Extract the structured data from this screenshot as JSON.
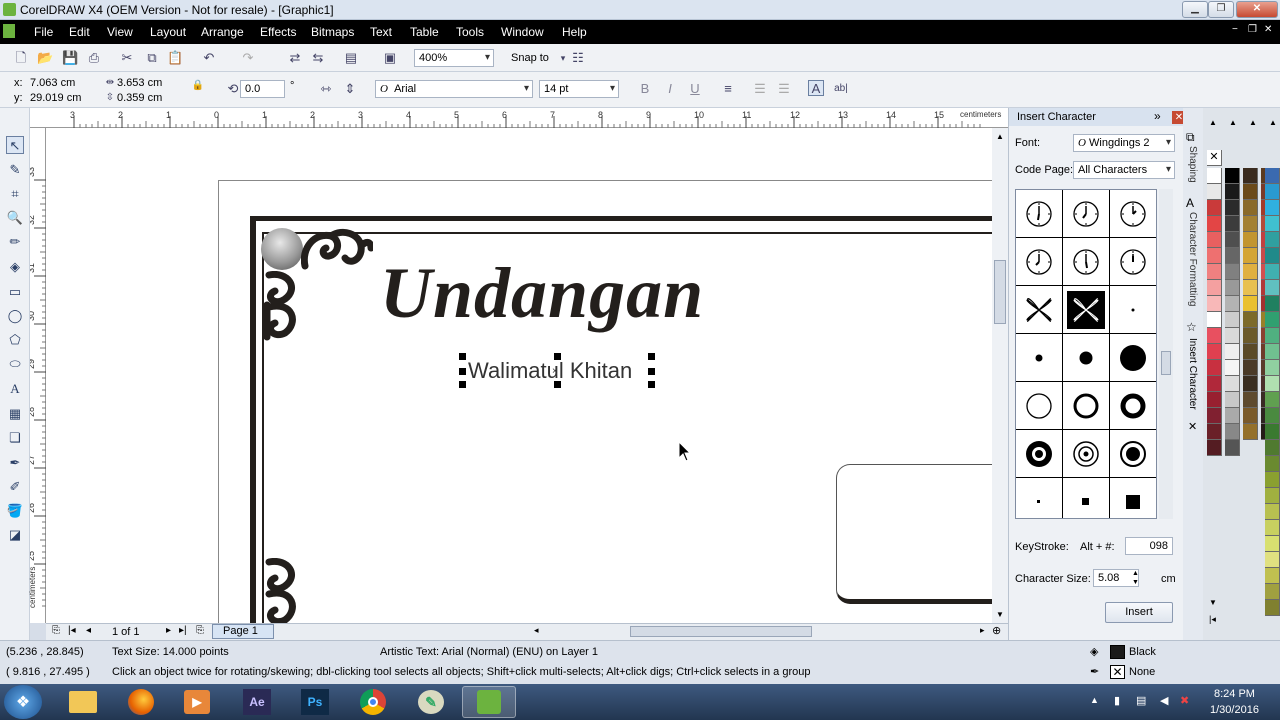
{
  "title_bar": {
    "title": "CorelDRAW X4 (OEM Version - Not for resale) - [Graphic1]"
  },
  "menu": {
    "file": "File",
    "edit": "Edit",
    "view": "View",
    "layout": "Layout",
    "arrange": "Arrange",
    "effects": "Effects",
    "bitmaps": "Bitmaps",
    "text": "Text",
    "table": "Table",
    "tools": "Tools",
    "window": "Window",
    "help": "Help"
  },
  "toolbar1": {
    "zoom_value": "400%",
    "snap_label": "Snap to"
  },
  "property_bar": {
    "x_label": "x:",
    "x_value": "7.063 cm",
    "y_label": "y:",
    "y_value": "29.019 cm",
    "width_value": "3.653 cm",
    "height_value": "0.359 cm",
    "rotation_value": "0.0",
    "rotation_unit": "°",
    "font_name": "Arial",
    "font_size": "14 pt"
  },
  "ruler": {
    "units": "centimeters",
    "h_ticks": [
      "3",
      "2",
      "1",
      "0",
      "1",
      "2",
      "3",
      "4",
      "5",
      "6",
      "7",
      "8",
      "9",
      "10",
      "11",
      "12",
      "13",
      "14",
      "15"
    ],
    "v_ticks": [
      "33",
      "32",
      "31",
      "30",
      "29",
      "28",
      "27",
      "26",
      "25"
    ],
    "v_units": "centimeters"
  },
  "canvas": {
    "heading_text": "Undangan",
    "subtitle_text": "Walimatul Khitan"
  },
  "page_nav": {
    "page_count": "1 of 1",
    "page_tab": "Page 1"
  },
  "docker": {
    "title": "Insert Character",
    "font_label": "Font:",
    "font_value": "Wingdings 2",
    "code_page_label": "Code Page:",
    "code_page_value": "All Characters",
    "keystroke_label": "KeyStroke:",
    "keystroke_prefix": "Alt + #:",
    "keystroke_value": "098",
    "size_label": "Character Size:",
    "size_value": "5.08",
    "size_unit": "cm",
    "insert_button": "Insert",
    "side_tabs": {
      "shaping": "Shaping",
      "char_format": "Character Formatting",
      "insert_char": "Insert Character"
    }
  },
  "status": {
    "cursor_coords": "(5.236 , 28.845)",
    "text_size": "Text Size: 14.000 points",
    "object_info": "Artistic Text: Arial (Normal) (ENU) on Layer 1",
    "coords2": "( 9.816 , 27.495 )",
    "hint": "Click an object twice for rotating/skewing; dbl-clicking tool selects all objects; Shift+click multi-selects; Alt+click digs; Ctrl+click selects in a group",
    "fill_label": "Black",
    "outline_label": "None"
  },
  "taskbar": {
    "time": "8:24 PM",
    "date": "1/30/2016"
  },
  "colors": {
    "palette": [
      "#ffffff",
      "#000000",
      "#3a2b1f",
      "#5b3a20",
      "#e8e8e8",
      "#1a1a1a",
      "#6b4a1a",
      "#7a3a2a",
      "#c93a3a",
      "#2b2b2b",
      "#8a6a2a",
      "#a33a2a",
      "#e34545",
      "#3c3c3c",
      "#a38033",
      "#b44a3a",
      "#e86060",
      "#4f4f4f",
      "#c29530",
      "#c04040",
      "#ee7070",
      "#666666",
      "#d4a535",
      "#c84a4a",
      "#f08080",
      "#808080",
      "#e0b040",
      "#d05050",
      "#f4a0a0",
      "#999999",
      "#e8c050",
      "#b03838",
      "#f8b8b8",
      "#b3b3b3",
      "#e9c030",
      "#a33030",
      "#ffffff",
      "#cccccc",
      "#7c6a2a",
      "#98802a",
      "#e85060",
      "#d9d9d9",
      "#6b5a2a",
      "#8a4030",
      "#e04050",
      "#efefef",
      "#5a4a28",
      "#6e3a2a",
      "#c83040",
      "#f5f5f5",
      "#4a3a28",
      "#5a3a2a",
      "#b0283a",
      "#dddddd",
      "#3a2e22",
      "#4a302a",
      "#982030",
      "#c8c8c8",
      "#5e4a2e",
      "#3a2a24",
      "#802030",
      "#aaaaaa",
      "#7a5a2a",
      "#2e2420",
      "#6a2028",
      "#888888",
      "#94702a",
      "#241c18",
      "#541c22",
      "#555555"
    ],
    "palette2": [
      "#3a6ab0",
      "#2a9ad0",
      "#30b0e0",
      "#40c0d0",
      "#30a0a0",
      "#208a8a",
      "#40b0b0",
      "#60c0c0",
      "#208060",
      "#30a070",
      "#50b080",
      "#70c090",
      "#90d0a0",
      "#b0e0b0",
      "#60a050",
      "#4a8a40",
      "#3a7a30",
      "#507a30",
      "#6a8a30",
      "#8aa030",
      "#a0b040",
      "#b8c050",
      "#c8d060",
      "#d8e070",
      "#e0e080",
      "#c0c050",
      "#a0a040",
      "#808030"
    ]
  }
}
